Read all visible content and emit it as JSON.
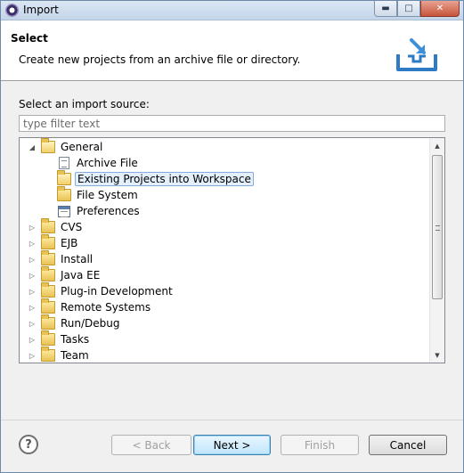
{
  "window": {
    "title": "Import"
  },
  "header": {
    "title": "Select",
    "description": "Create new projects from an archive file or directory."
  },
  "import_source": {
    "label": "Select an import source:",
    "filter_placeholder": "type filter text"
  },
  "tree": {
    "general": "General",
    "general_children": [
      "Archive File",
      "Existing Projects into Workspace",
      "File System",
      "Preferences"
    ],
    "categories": [
      "CVS",
      "EJB",
      "Install",
      "Java EE",
      "Plug-in Development",
      "Remote Systems",
      "Run/Debug",
      "Tasks",
      "Team"
    ],
    "selected": "Existing Projects into Workspace"
  },
  "buttons": {
    "help": "?",
    "back": "< Back",
    "next": "Next >",
    "finish": "Finish",
    "cancel": "Cancel"
  },
  "icons": {
    "app": "eclipse-icon",
    "header": "import-tray-icon",
    "folder": "folder-icon",
    "archive": "archive-file-icon",
    "preferences": "preferences-icon"
  }
}
